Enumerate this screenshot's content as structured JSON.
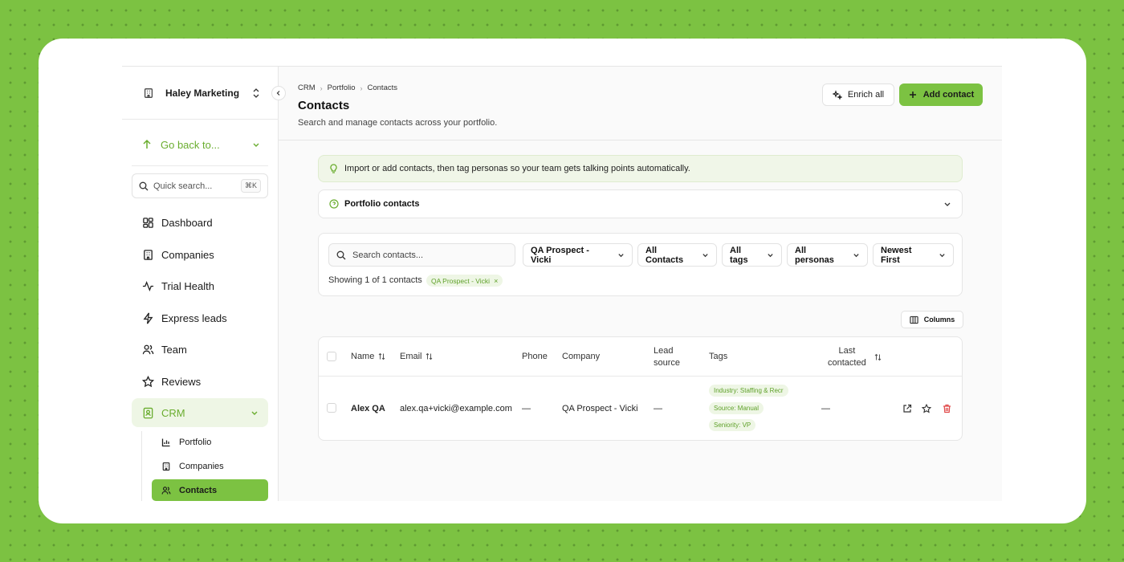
{
  "org": {
    "name": "Haley Marketing"
  },
  "sidebar": {
    "go_back": "Go back to...",
    "quick_search": {
      "placeholder": "Quick search...",
      "shortcut": "⌘K"
    },
    "items": [
      {
        "label": "Dashboard",
        "icon": "dashboard-icon"
      },
      {
        "label": "Companies",
        "icon": "building-icon"
      },
      {
        "label": "Trial Health",
        "icon": "activity-icon"
      },
      {
        "label": "Express leads",
        "icon": "lightning-icon"
      },
      {
        "label": "Team",
        "icon": "users-icon"
      },
      {
        "label": "Reviews",
        "icon": "star-icon"
      },
      {
        "label": "CRM",
        "icon": "contact-book-icon",
        "expanded": true
      }
    ],
    "crm_children": [
      {
        "label": "Portfolio",
        "icon": "bar-chart-icon"
      },
      {
        "label": "Companies",
        "icon": "building-icon"
      },
      {
        "label": "Contacts",
        "icon": "users-icon",
        "active": true
      }
    ]
  },
  "header": {
    "breadcrumb": [
      "CRM",
      "Portfolio",
      "Contacts"
    ],
    "title": "Contacts",
    "subtitle": "Search and manage contacts across your portfolio.",
    "enrich_label": "Enrich all",
    "add_label": "Add contact"
  },
  "banner": {
    "text": "Import or add contacts, then tag personas so your team gets talking points automatically."
  },
  "section": {
    "title": "Portfolio contacts"
  },
  "filters": {
    "search_placeholder": "Search contacts...",
    "portfolio": "QA Prospect - Vicki",
    "contacts": "All Contacts",
    "tags": "All tags",
    "personas": "All personas",
    "sort": "Newest First",
    "showing": "Showing 1 of 1 contacts",
    "active_chip": "QA Prospect - Vicki",
    "chip_remove": "×"
  },
  "columns_label": "Columns",
  "table": {
    "headers": {
      "name": "Name",
      "email": "Email",
      "phone": "Phone",
      "company": "Company",
      "lead_source_1": "Lead",
      "lead_source_2": "source",
      "tags": "Tags",
      "last_contacted_1": "Last",
      "last_contacted_2": "contacted"
    },
    "rows": [
      {
        "name": "Alex QA",
        "email": "alex.qa+vicki@example.com",
        "phone": "—",
        "company": "QA Prospect - Vicki",
        "lead_source": "—",
        "tags": [
          "Industry: Staffing & Recr",
          "Source: Manual",
          "Seniority: VP"
        ],
        "last_contacted": "—"
      }
    ]
  },
  "colors": {
    "accent": "#7cc242",
    "accent_text": "#6aad2f",
    "tag_bg": "#eef6e5",
    "danger": "#e04848"
  }
}
